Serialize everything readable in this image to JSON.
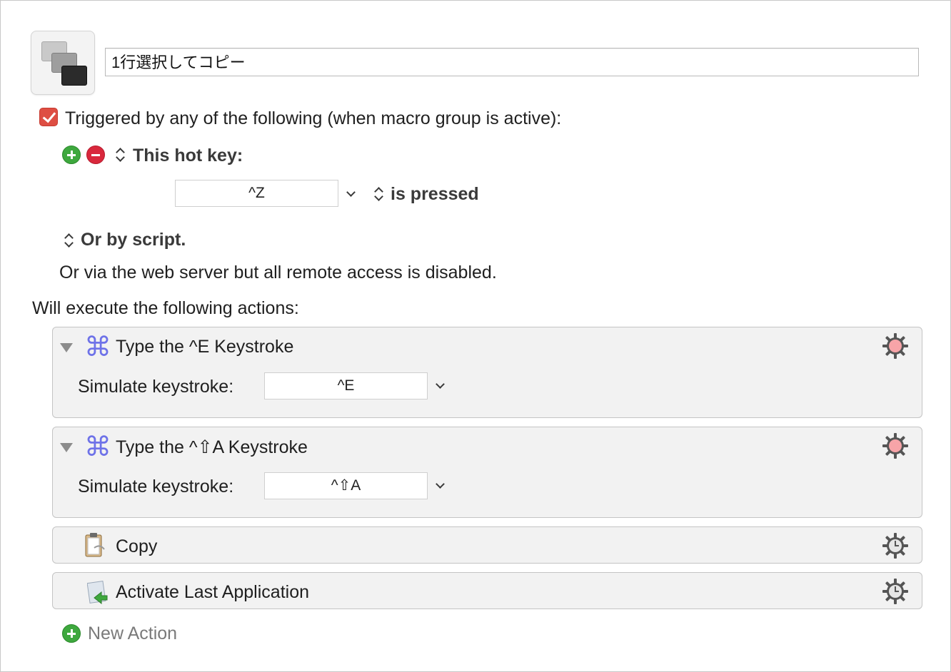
{
  "macro": {
    "name": "1行選択してコピー",
    "icon": "macro-windows-icon"
  },
  "triggers": {
    "enabled_label": "Triggered by any of the following (when macro group is active):",
    "enabled": true,
    "hotkey_label": "This hot key:",
    "hotkey_value": "^Z",
    "hotkey_condition": "is pressed",
    "script_label": "Or by script.",
    "web_label": "Or via the web server but all remote access is disabled."
  },
  "actions_header": "Will execute the following actions:",
  "actions": [
    {
      "title": "Type the ^E Keystroke",
      "field_label": "Simulate keystroke:",
      "keystroke": "^E",
      "icon": "command-icon",
      "gear_state": "pink"
    },
    {
      "title": "Type the ^⇧A Keystroke",
      "field_label": "Simulate keystroke:",
      "keystroke": "^⇧A",
      "icon": "command-icon",
      "gear_state": "pink"
    },
    {
      "title": "Copy",
      "icon": "clipboard-icon",
      "gear_state": "gray"
    },
    {
      "title": "Activate Last Application",
      "icon": "activate-app-icon",
      "gear_state": "gray"
    }
  ],
  "new_action_label": "New Action",
  "colors": {
    "checkbox": "#de4e43",
    "plus": "#3ea83e",
    "minus": "#d9283c",
    "command": "#6e72e8",
    "gear_pink": "#f7a4a8"
  }
}
